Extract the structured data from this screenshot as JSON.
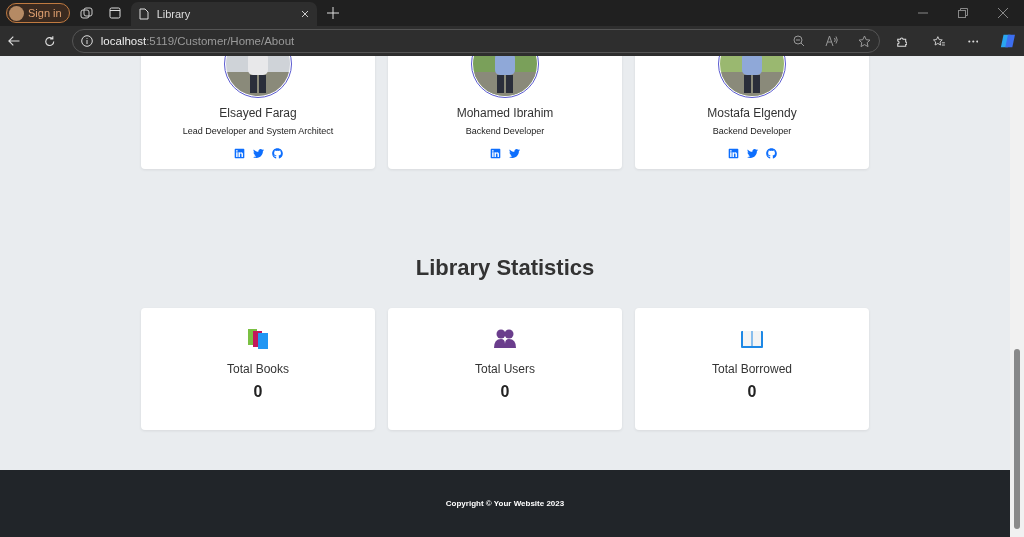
{
  "browser": {
    "profile_label": "Sign in",
    "tab": {
      "title": "Library",
      "selected": true
    },
    "address": {
      "host": "localhost",
      "path": ":5119/Customer/Home/About"
    }
  },
  "team": [
    {
      "name": "Elsayed Farag",
      "role": "Lead Developer and System Architect",
      "photo": {
        "kind": "picture"
      },
      "links": [
        {
          "kind": "linkedin"
        },
        {
          "kind": "twitter"
        },
        {
          "kind": "github"
        }
      ]
    },
    {
      "name": "Mohamed Ibrahim",
      "role": "Backend Developer",
      "photo": {
        "kind": "picture"
      },
      "links": [
        {
          "kind": "linkedin"
        },
        {
          "kind": "twitter"
        }
      ]
    },
    {
      "name": "Mostafa Elgendy",
      "role": "Backend Developer",
      "photo": {
        "kind": "picture"
      },
      "links": [
        {
          "kind": "linkedin"
        },
        {
          "kind": "twitter"
        },
        {
          "kind": "github"
        }
      ]
    }
  ],
  "statistics": {
    "title": "Library Statistics",
    "items": [
      {
        "kind": "books",
        "label": "Total Books",
        "value": "0"
      },
      {
        "kind": "users",
        "label": "Total Users",
        "value": "0"
      },
      {
        "kind": "borrowed",
        "label": "Total Borrowed",
        "value": "0"
      }
    ]
  },
  "footer": {
    "text": "Copyright © Your Website 2023"
  }
}
